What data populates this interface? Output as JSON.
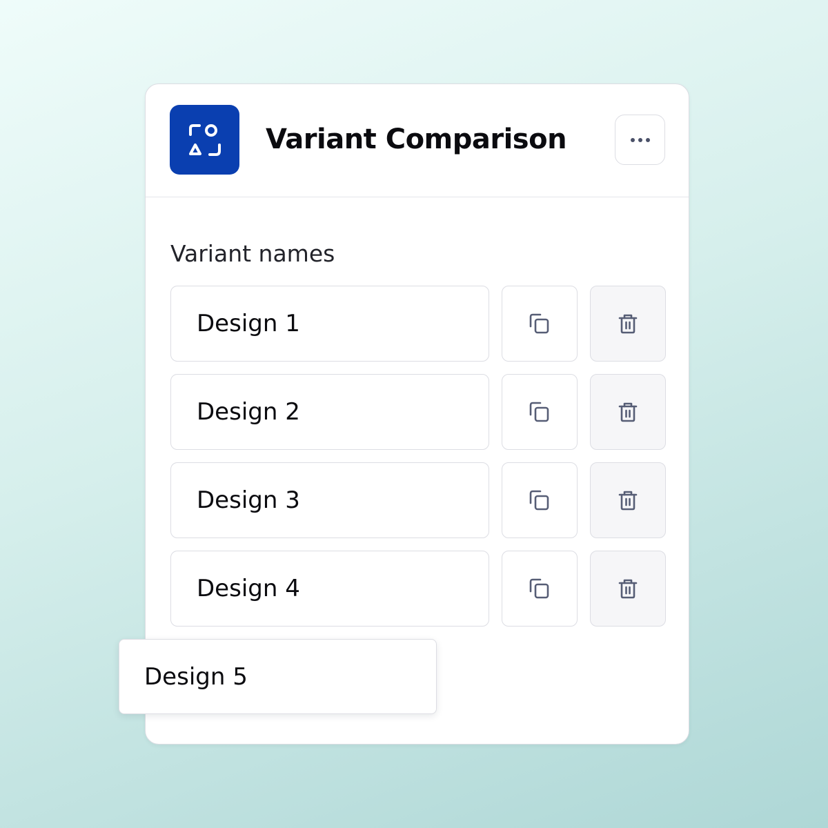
{
  "header": {
    "title": "Variant Comparison",
    "app_icon": "shapes-icon",
    "more_icon": "more-horizontal-icon",
    "accent_color": "#0a3fb0"
  },
  "section": {
    "label": "Variant names"
  },
  "variants": [
    {
      "name": "Design 1",
      "copy_icon": "copy-icon",
      "delete_icon": "trash-icon"
    },
    {
      "name": "Design 2",
      "copy_icon": "copy-icon",
      "delete_icon": "trash-icon"
    },
    {
      "name": "Design 3",
      "copy_icon": "copy-icon",
      "delete_icon": "trash-icon"
    },
    {
      "name": "Design 4",
      "copy_icon": "copy-icon",
      "delete_icon": "trash-icon"
    }
  ],
  "dragged_item": {
    "name": "Design 5"
  }
}
